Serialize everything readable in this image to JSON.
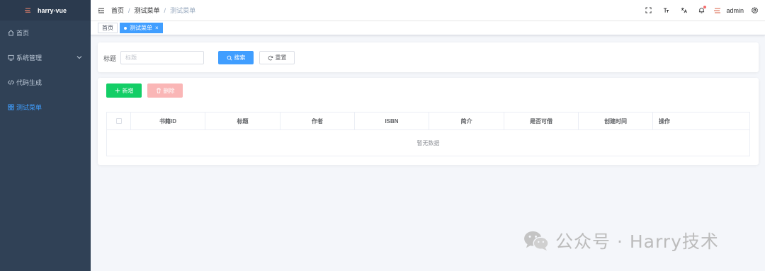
{
  "sidebar": {
    "logo_text": "harry-vue",
    "items": [
      {
        "label": "首页",
        "icon": "home-icon"
      },
      {
        "label": "系统管理",
        "icon": "monitor-icon",
        "has_children": true
      },
      {
        "label": "代码生成",
        "icon": "code-icon"
      },
      {
        "label": "测试菜单",
        "icon": "grid-icon",
        "active": true
      }
    ],
    "active_color": "#409eff"
  },
  "navbar": {
    "breadcrumb": [
      "首页",
      "测试菜单",
      "测试菜单"
    ],
    "breadcrumb_sep": "/",
    "username": "admin",
    "icons": [
      "fullscreen-icon",
      "font-size-icon",
      "translate-icon",
      "bell-icon",
      "settings-icon"
    ]
  },
  "tags": [
    {
      "label": "首页",
      "active": false
    },
    {
      "label": "测试菜单",
      "active": true,
      "close": "×"
    }
  ],
  "search": {
    "title_label": "标题",
    "title_placeholder": "标题",
    "search_button": "搜索",
    "reset_button": "重置"
  },
  "toolbar": {
    "add_button": "新增",
    "delete_button": "删除"
  },
  "table": {
    "columns": [
      "书籍ID",
      "标题",
      "作者",
      "ISBN",
      "简介",
      "是否可借",
      "创建时间",
      "操作"
    ],
    "empty_text": "暂无数据"
  },
  "watermark": {
    "text": "公众号 · Harry技术"
  },
  "colors": {
    "primary": "#409eff",
    "success": "#13ce66",
    "danger_disabled": "#fab6b6",
    "sidebar_bg": "#304156"
  }
}
